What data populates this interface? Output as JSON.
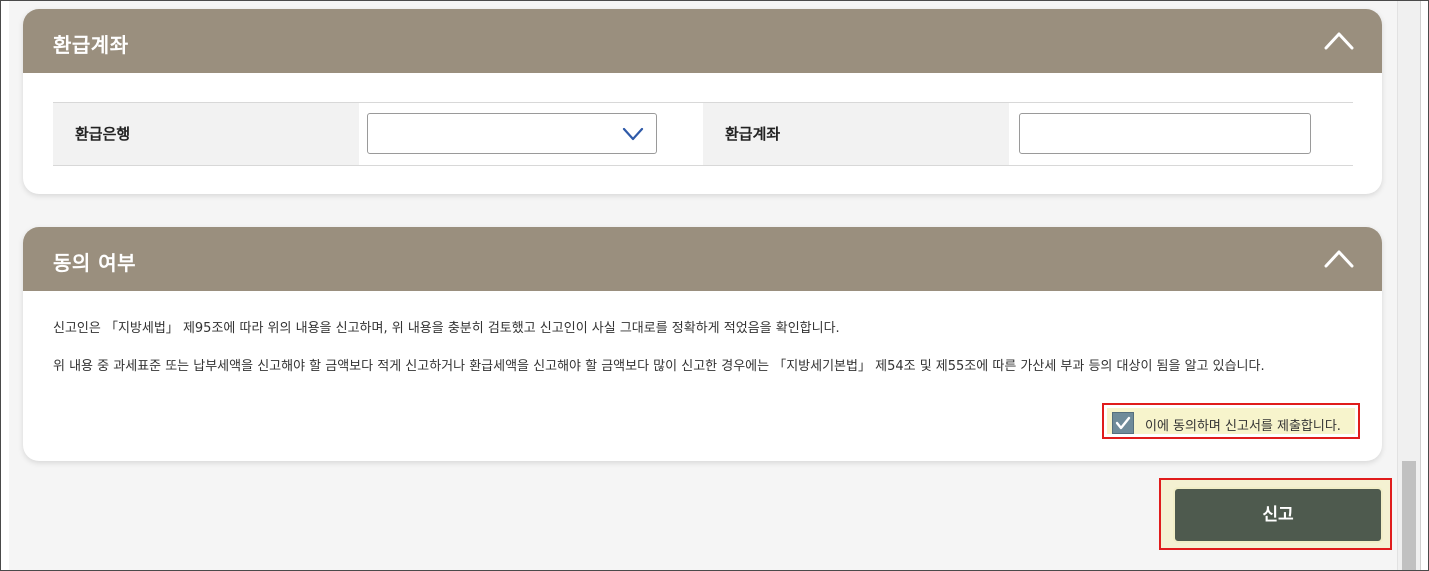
{
  "refund_account": {
    "title": "환급계좌",
    "bank_label": "환급은행",
    "bank_select_value": "",
    "account_label": "환급계좌",
    "account_value": ""
  },
  "agreement": {
    "title": "동의 여부",
    "text1": "신고인은 「지방세법」 제95조에 따라 위의 내용을 신고하며, 위 내용을 충분히 검토했고 신고인이 사실 그대로를 정확하게 적었음을 확인합니다.",
    "text2": "위 내용 중 과세표준 또는 납부세액을 신고해야 할 금액보다 적게 신고하거나 환급세액을 신고해야 할 금액보다 많이 신고한 경우에는 「지방세기본법」 제54조 및 제55조에 따른 가산세 부과 등의 대상이 됨을 알고 있습니다.",
    "checkbox_label": "이에 동의하며 신고서를 제출합니다.",
    "checked": true
  },
  "submit": {
    "label": "신고"
  },
  "colors": {
    "header_bg": "#9a8f7e",
    "submit_bg": "#4e5a4e",
    "highlight_border": "#e01c1c",
    "checkbox_bg": "#6f8b9a",
    "select_chevron": "#2f5aa8"
  },
  "icons": {
    "collapse": "chevron-up-icon",
    "select": "chevron-down-icon",
    "check": "check-icon"
  }
}
